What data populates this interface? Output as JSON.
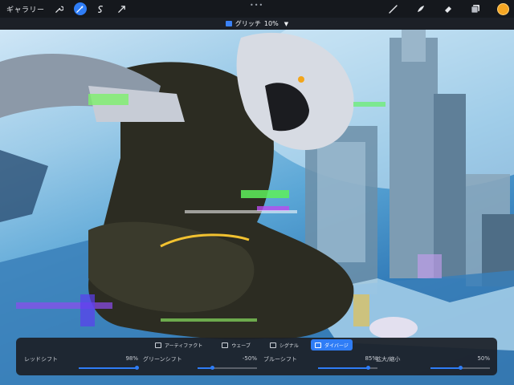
{
  "topbar": {
    "gallery_label": "ギャラリー",
    "left_tools": [
      "wrench-icon",
      "magic-wand-icon",
      "selection-icon",
      "transform-icon"
    ],
    "active_tool": "magic-wand-icon",
    "right_tools": [
      "brush-icon",
      "smudge-icon",
      "eraser-icon",
      "layers-icon"
    ],
    "current_color": "#f5a623",
    "more_dots": "•••"
  },
  "adjustment": {
    "name": "グリッチ",
    "percent": "10%"
  },
  "panel": {
    "tabs": [
      {
        "label": "アーティファクト",
        "icon": "artifact-icon"
      },
      {
        "label": "ウェーブ",
        "icon": "wave-icon"
      },
      {
        "label": "シグナル",
        "icon": "signal-icon"
      },
      {
        "label": "ダイバージ",
        "icon": "diverge-icon"
      }
    ],
    "selected_tab": "ダイバージ",
    "sliders": [
      {
        "label": "レッドシフト",
        "value": "98%",
        "level": 0.98
      },
      {
        "label": "グリーンシフト",
        "value": "-50%",
        "level": 0.25
      },
      {
        "label": "ブルーシフト",
        "value": "85%",
        "level": 0.85
      },
      {
        "label": "拡大/縮小",
        "value": "50%",
        "level": 0.5
      }
    ]
  },
  "colors": {
    "accent": "#2f7df6",
    "toolbar_bg": "#15181d",
    "panel_bg": "#1c2028"
  }
}
